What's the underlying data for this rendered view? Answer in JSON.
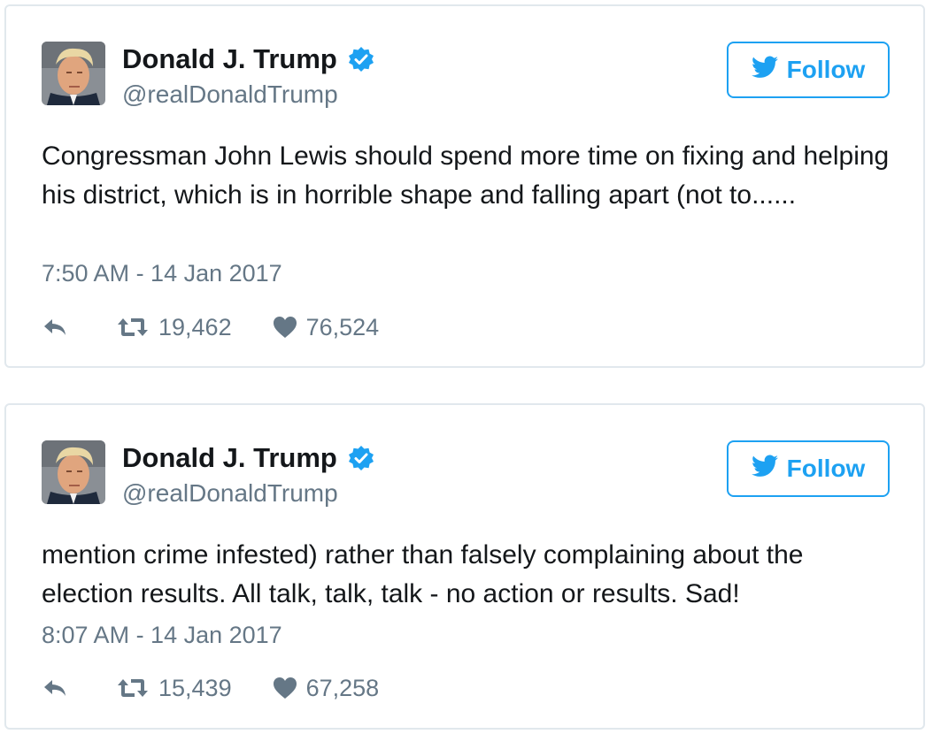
{
  "colors": {
    "accent": "#1da1f2",
    "muted": "#657786",
    "text": "#14171a",
    "border": "#e1e8ed",
    "verified": "#1da1f2"
  },
  "tweets": [
    {
      "author": {
        "name": "Donald J. Trump",
        "handle": "@realDonaldTrump",
        "verified": true,
        "avatar_icon": "profile-photo"
      },
      "follow_label": "Follow",
      "text": "Congressman John Lewis should spend more time on fixing and helping his district, which is in horrible shape and falling apart (not to......",
      "timestamp": "7:50 AM - 14 Jan 2017",
      "retweets": "19,462",
      "likes": "76,524"
    },
    {
      "author": {
        "name": "Donald J. Trump",
        "handle": "@realDonaldTrump",
        "verified": true,
        "avatar_icon": "profile-photo"
      },
      "follow_label": "Follow",
      "text": "mention crime infested) rather than falsely complaining about the election results. All talk, talk, talk - no action or results. Sad!",
      "timestamp": "8:07 AM - 14 Jan 2017",
      "retweets": "15,439",
      "likes": "67,258"
    }
  ]
}
